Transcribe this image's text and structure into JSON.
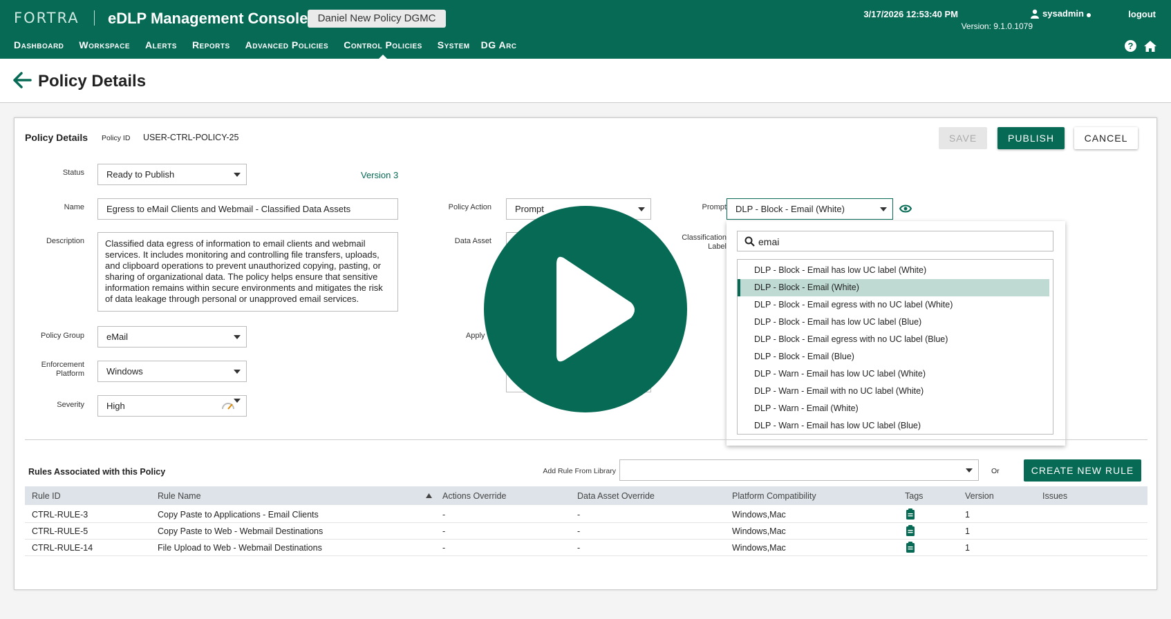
{
  "header": {
    "brand": "FORTRA",
    "app_title": "eDLP Management Console",
    "policy_badge": "Daniel New Policy DGMC",
    "datetime": "3/17/2026 12:53:40 PM",
    "user": "sysadmin",
    "logout": "logout",
    "version": "Version: 9.1.0.1079",
    "nav": [
      "Dashboard",
      "Workspace",
      "Alerts",
      "Reports",
      "Advanced Policies",
      "Control Policies",
      "System",
      "DG Arc"
    ],
    "active_nav": "Control Policies",
    "help_icon": "?"
  },
  "page": {
    "title": "Policy Details"
  },
  "policy": {
    "section_title": "Policy Details",
    "id_label": "Policy ID",
    "id_value": "USER-CTRL-POLICY-25",
    "save": "SAVE",
    "publish": "PUBLISH",
    "cancel": "CANCEL",
    "status_label": "Status",
    "status_value": "Ready to Publish",
    "version": "Version 3",
    "name_label": "Name",
    "name_value": "Egress to eMail Clients and Webmail - Classified Data Assets",
    "description_label": "Description",
    "description_value": "Classified data egress of information to email clients and webmail services. It includes monitoring and controlling file transfers, uploads, and clipboard operations to prevent unauthorized copying, pasting, or sharing of organizational data. The policy helps ensure that sensitive information remains within secure environments and mitigates the risk of data leakage through personal or unapproved email services.",
    "group_label": "Policy Group",
    "group_value": "eMail",
    "platform_label_1": "Enforcement",
    "platform_label_2": "Platform",
    "platform_value": "Windows",
    "severity_label": "Severity",
    "severity_value": "High",
    "action_label": "Policy Action",
    "action_value": "Prompt",
    "data_asset_label": "Data Asset",
    "apply_label": "Apply T",
    "prompt_label": "Prompt",
    "prompt_value": "DLP - Block - Email (White)",
    "classification_label_1": "Classification",
    "classification_label_2": "Label"
  },
  "dropdown": {
    "search_value": "emai",
    "options": [
      "DLP - Block - Email has low UC label (White)",
      "DLP - Block - Email (White)",
      "DLP - Block - Email egress with no UC label (White)",
      "DLP - Block - Email has low UC label (Blue)",
      "DLP - Block - Email egress with no UC label (Blue)",
      "DLP - Block - Email (Blue)",
      "DLP - Warn - Email has low UC label (White)",
      "DLP - Warn - Email with no UC label (White)",
      "DLP - Warn - Email (White)",
      "DLP - Warn - Email has low UC label (Blue)"
    ],
    "selected": "DLP - Block - Email (White)"
  },
  "rules": {
    "title": "Rules Associated with this Policy",
    "add_label": "Add Rule From Library",
    "or": "Or",
    "create": "CREATE NEW RULE",
    "columns": [
      "Rule ID",
      "Rule Name",
      "Actions Override",
      "Data Asset Override",
      "Platform Compatibility",
      "Tags",
      "Version",
      "Issues"
    ],
    "rows": [
      [
        "CTRL-RULE-3",
        "Copy Paste to Applications - Email Clients",
        "-",
        "-",
        "Windows,Mac",
        "",
        "1",
        ""
      ],
      [
        "CTRL-RULE-5",
        "Copy Paste to Web - Webmail Destinations",
        "-",
        "-",
        "Windows,Mac",
        "",
        "1",
        ""
      ],
      [
        "CTRL-RULE-14",
        "File Upload to Web - Webmail Destinations",
        "-",
        "-",
        "Windows,Mac",
        "",
        "1",
        ""
      ]
    ]
  },
  "colors": {
    "primary": "#066a55",
    "selected_row": "#bedad3"
  }
}
